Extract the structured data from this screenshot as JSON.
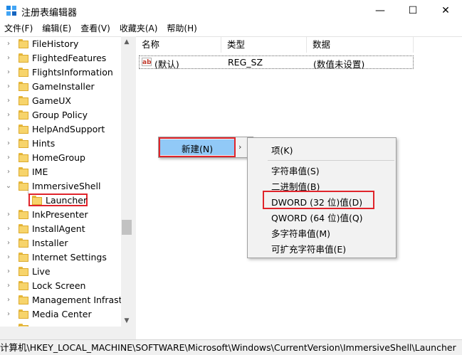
{
  "window": {
    "title": "注册表编辑器",
    "minimize_glyph": "—",
    "maximize_glyph": "☐",
    "close_glyph": "✕"
  },
  "menubar": {
    "items": [
      "文件(F)",
      "编辑(E)",
      "查看(V)",
      "收藏夹(A)",
      "帮助(H)"
    ]
  },
  "tree": {
    "items": [
      {
        "label": "FileHistory",
        "expander": "›"
      },
      {
        "label": "FlightedFeatures",
        "expander": "›"
      },
      {
        "label": "FlightsInformation",
        "expander": "›"
      },
      {
        "label": "GameInstaller",
        "expander": "›"
      },
      {
        "label": "GameUX",
        "expander": "›"
      },
      {
        "label": "Group Policy",
        "expander": "›"
      },
      {
        "label": "HelpAndSupport",
        "expander": "›"
      },
      {
        "label": "Hints",
        "expander": "›"
      },
      {
        "label": "HomeGroup",
        "expander": "›"
      },
      {
        "label": "IME",
        "expander": "›"
      },
      {
        "label": "ImmersiveShell",
        "expander": "⌄"
      },
      {
        "label": "Launcher",
        "expander": ""
      },
      {
        "label": "InkPresenter",
        "expander": "›"
      },
      {
        "label": "InstallAgent",
        "expander": "›"
      },
      {
        "label": "Installer",
        "expander": "›"
      },
      {
        "label": "Internet Settings",
        "expander": "›"
      },
      {
        "label": "Live",
        "expander": "›"
      },
      {
        "label": "Lock Screen",
        "expander": "›"
      },
      {
        "label": "Management Infrastr",
        "expander": "›"
      },
      {
        "label": "Media Center",
        "expander": "›"
      }
    ],
    "selected": "Launcher",
    "scroll_up": "▲",
    "scroll_down": "▼"
  },
  "list": {
    "columns": [
      "名称",
      "类型",
      "数据"
    ],
    "rows": [
      {
        "icon": "ab",
        "name": "(默认)",
        "type": "REG_SZ",
        "data": "(数值未设置)"
      }
    ]
  },
  "context_menu": {
    "item_label": "新建(N)",
    "arrow": "›"
  },
  "submenu": {
    "key": "项(K)",
    "string": "字符串值(S)",
    "binary": "二进制值(B)",
    "dword": "DWORD (32 位)值(D)",
    "qword": "QWORD (64 位)值(Q)",
    "multi_string": "多字符串值(M)",
    "expandable_string": "可扩充字符串值(E)"
  },
  "statusbar": {
    "path": "计算机\\HKEY_LOCAL_MACHINE\\SOFTWARE\\Microsoft\\Windows\\CurrentVersion\\ImmersiveShell\\Launcher"
  },
  "colors": {
    "highlight_outline": "#e0242b",
    "menu_hover": "#91c9f7",
    "folder": "#f7d46b"
  }
}
